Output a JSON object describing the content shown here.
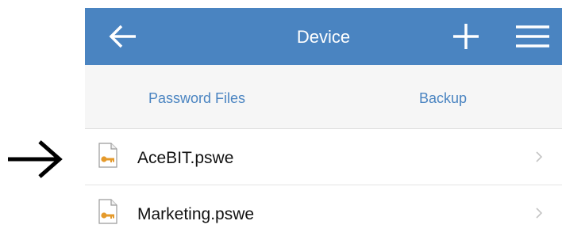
{
  "header": {
    "title": "Device",
    "back_icon": "back-arrow-icon",
    "add_icon": "plus-icon",
    "menu_icon": "hamburger-menu-icon"
  },
  "tabs": [
    {
      "label": "Password Files"
    },
    {
      "label": "Backup"
    }
  ],
  "files": [
    {
      "name": "AceBIT.pswe",
      "icon": "password-file-key-icon"
    },
    {
      "name": "Marketing.pswe",
      "icon": "password-file-key-icon"
    }
  ],
  "annotation": {
    "icon": "pointer-arrow-icon"
  },
  "colors": {
    "accent": "#4a84c1",
    "key": "#e59a2b",
    "segment_bg": "#f6f6f6"
  }
}
